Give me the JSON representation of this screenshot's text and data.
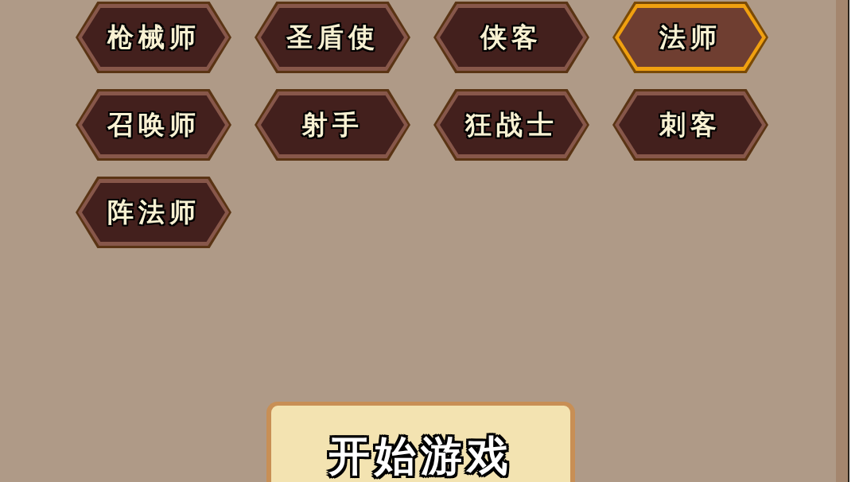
{
  "classes": [
    {
      "label": "枪械师",
      "selected": false
    },
    {
      "label": "圣盾使",
      "selected": false
    },
    {
      "label": "侠客",
      "selected": false
    },
    {
      "label": "法师",
      "selected": true
    },
    {
      "label": "召唤师",
      "selected": false
    },
    {
      "label": "射手",
      "selected": false
    },
    {
      "label": "狂战士",
      "selected": false
    },
    {
      "label": "刺客",
      "selected": false
    },
    {
      "label": "阵法师",
      "selected": false
    }
  ],
  "start_button": {
    "label": "开始游戏"
  }
}
